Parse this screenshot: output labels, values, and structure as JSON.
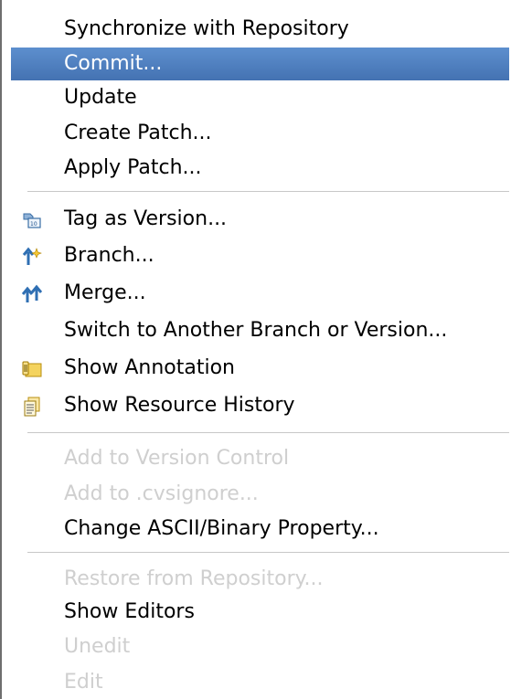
{
  "menu": {
    "items": [
      {
        "label": "Synchronize with Repository",
        "state": "normal"
      },
      {
        "label": "Commit...",
        "state": "selected"
      },
      {
        "label": "Update",
        "state": "normal"
      },
      {
        "label": "Create Patch...",
        "state": "normal"
      },
      {
        "label": "Apply Patch...",
        "state": "normal"
      },
      {
        "label": "Tag as Version...",
        "state": "normal",
        "icon": "tag-icon"
      },
      {
        "label": "Branch...",
        "state": "normal",
        "icon": "branch-icon"
      },
      {
        "label": "Merge...",
        "state": "normal",
        "icon": "merge-icon"
      },
      {
        "label": "Switch to Another Branch or Version...",
        "state": "normal"
      },
      {
        "label": "Show Annotation",
        "state": "normal",
        "icon": "annotation-icon"
      },
      {
        "label": "Show Resource History",
        "state": "normal",
        "icon": "history-icon"
      },
      {
        "label": "Add to Version Control",
        "state": "disabled"
      },
      {
        "label": "Add to .cvsignore...",
        "state": "disabled"
      },
      {
        "label": "Change ASCII/Binary Property...",
        "state": "normal"
      },
      {
        "label": "Restore from Repository...",
        "state": "disabled"
      },
      {
        "label": "Show Editors",
        "state": "normal"
      },
      {
        "label": "Unedit",
        "state": "disabled"
      },
      {
        "label": "Edit",
        "state": "disabled"
      }
    ]
  },
  "colors": {
    "selection": "#4f80c0",
    "disabled_text": "#cfcfcf",
    "separator": "#c8c8c8"
  }
}
